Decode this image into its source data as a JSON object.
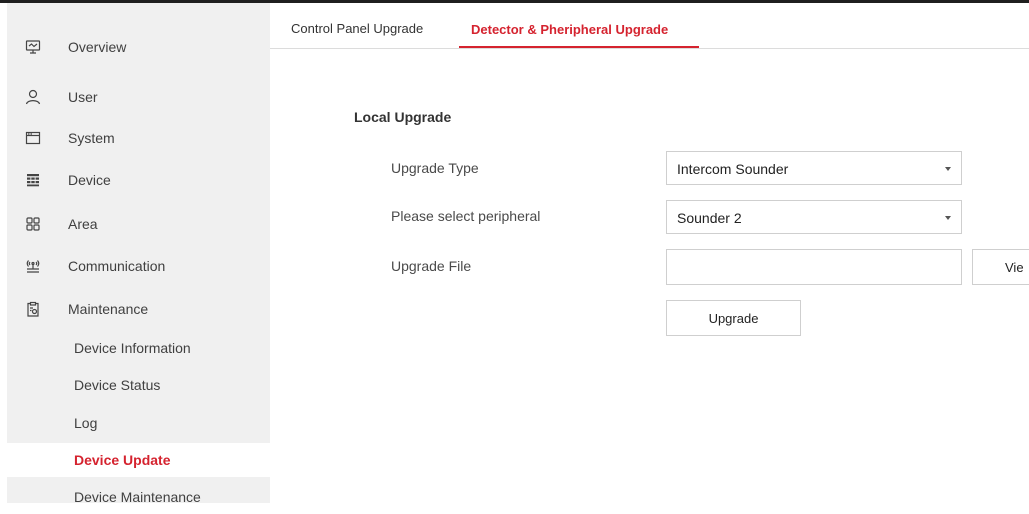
{
  "sidebar": {
    "items": [
      {
        "label": "Overview",
        "icon": "monitor-icon"
      },
      {
        "label": "User",
        "icon": "user-icon"
      },
      {
        "label": "System",
        "icon": "window-icon"
      },
      {
        "label": "Device",
        "icon": "device-grid-icon"
      },
      {
        "label": "Area",
        "icon": "area-grid-icon"
      },
      {
        "label": "Communication",
        "icon": "signal-tower-icon"
      },
      {
        "label": "Maintenance",
        "icon": "maintenance-clipboard-icon"
      }
    ],
    "sub_items": [
      {
        "label": "Device Information"
      },
      {
        "label": "Device Status"
      },
      {
        "label": "Log"
      },
      {
        "label": "Device Update",
        "active": true
      },
      {
        "label": "Device Maintenance"
      }
    ]
  },
  "tabs": [
    {
      "label": "Control Panel Upgrade",
      "active": false
    },
    {
      "label": "Detector & Pheripheral Upgrade",
      "active": true
    }
  ],
  "form": {
    "section_title": "Local Upgrade",
    "upgrade_type": {
      "label": "Upgrade Type",
      "value": "Intercom Sounder"
    },
    "peripheral": {
      "label": "Please select peripheral",
      "value": "Sounder 2"
    },
    "upgrade_file": {
      "label": "Upgrade File",
      "value": ""
    },
    "view_button": "Vie",
    "upgrade_button": "Upgrade"
  },
  "colors": {
    "accent": "#d5232f",
    "sidebar_bg": "#f0f0f0"
  }
}
